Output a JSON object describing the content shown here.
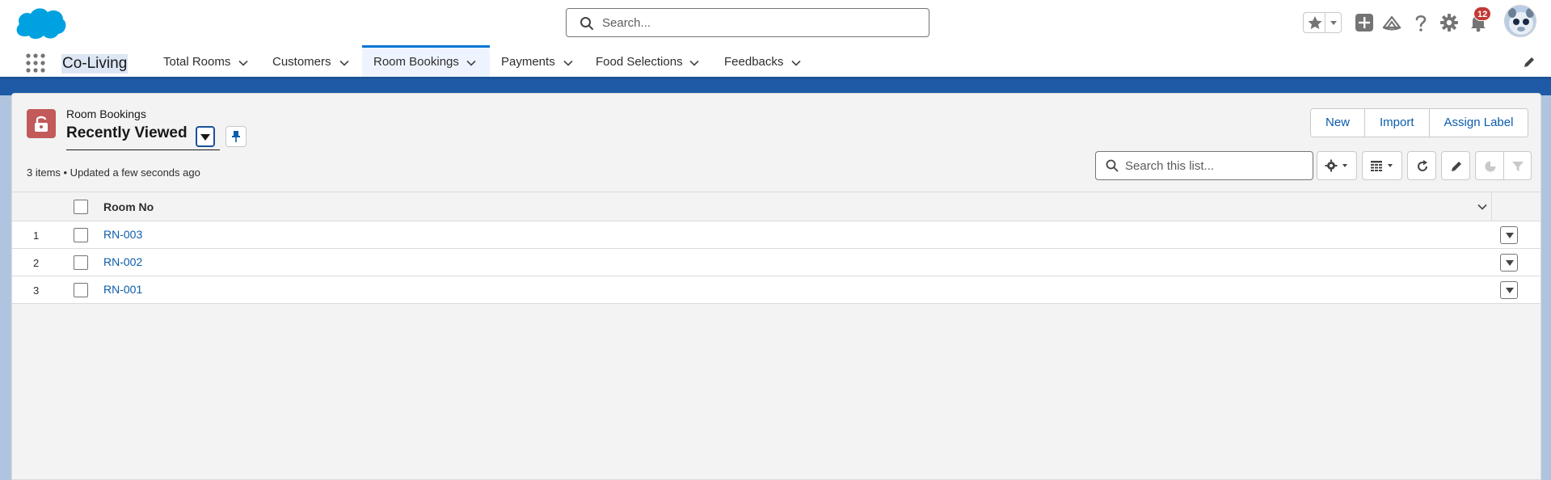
{
  "header": {
    "search_placeholder": "Search...",
    "notification_count": "12",
    "icons": [
      "favorites-star-icon",
      "add-icon",
      "trailhead-icon",
      "help-icon",
      "setup-gear-icon",
      "notification-bell-icon",
      "user-avatar"
    ]
  },
  "nav": {
    "app_name": "Co-Living",
    "items": [
      {
        "label": "Total Rooms",
        "active": false
      },
      {
        "label": "Customers",
        "active": false
      },
      {
        "label": "Room Bookings",
        "active": true
      },
      {
        "label": "Payments",
        "active": false
      },
      {
        "label": "Food Selections",
        "active": false
      },
      {
        "label": "Feedbacks",
        "active": false
      }
    ]
  },
  "list": {
    "object_label": "Room Bookings",
    "view_name": "Recently Viewed",
    "meta": "3 items • Updated a few seconds ago",
    "buttons": {
      "new": "New",
      "import": "Import",
      "assign_label": "Assign Label"
    },
    "search_placeholder": "Search this list...",
    "column_header": "Room No",
    "rows": [
      {
        "num": "1",
        "room_no": "RN-003"
      },
      {
        "num": "2",
        "room_no": "RN-002"
      },
      {
        "num": "3",
        "room_no": "RN-001"
      }
    ]
  },
  "colors": {
    "brand_blue": "#0176d3",
    "link": "#0b5cab",
    "object_icon": "#c25a5a",
    "badge": "#c23934"
  }
}
